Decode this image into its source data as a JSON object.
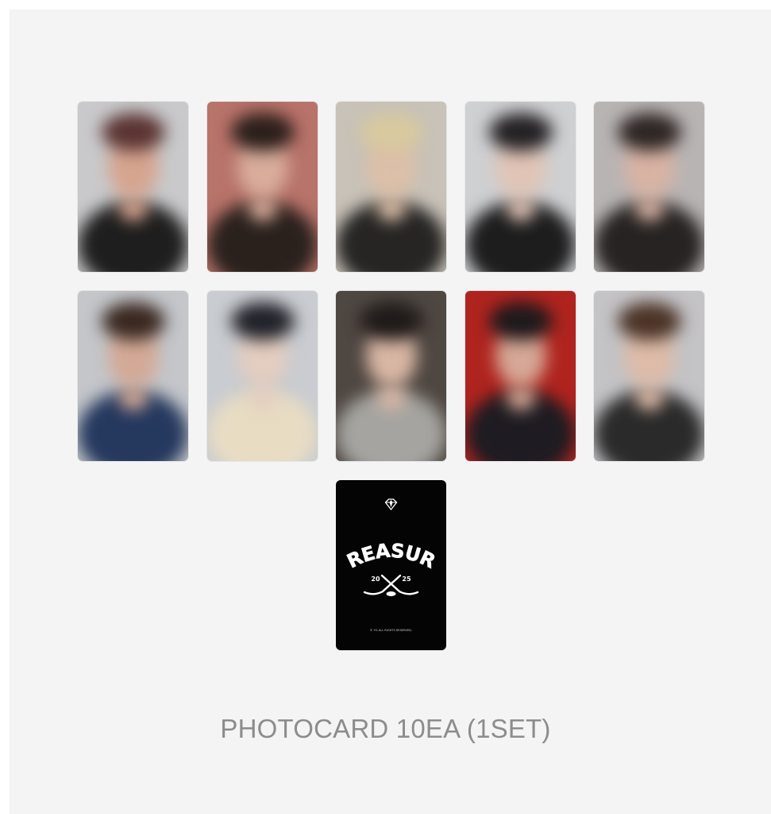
{
  "caption": "PHOTOCARD 10EA (1SET)",
  "back_card": {
    "brand": "TREASURE",
    "year_left": "20",
    "year_right": "25",
    "copyright": "© YG ALL RIGHTS RESERVED."
  },
  "photocards": [
    {
      "bg": "#c9c9cb",
      "hair": "#5a3432",
      "skin": "#d6a48f",
      "cloth": "#1e1e1e"
    },
    {
      "bg": "#b8736a",
      "hair": "#2b1f1b",
      "skin": "#d9ad9c",
      "cloth": "#2a211d"
    },
    {
      "bg": "#c8c2b8",
      "hair": "#d8c99e",
      "skin": "#dcbfa8",
      "cloth": "#262524"
    },
    {
      "bg": "#cfd0d2",
      "hair": "#242124",
      "skin": "#e0c4b6",
      "cloth": "#1d1d1e"
    },
    {
      "bg": "#b9b4b4",
      "hair": "#2e2624",
      "skin": "#d8b3a4",
      "cloth": "#262322"
    },
    {
      "bg": "#c4c6ca",
      "hair": "#3a2820",
      "skin": "#d3a996",
      "cloth": "#25385e"
    },
    {
      "bg": "#c9ccd1",
      "hair": "#22222a",
      "skin": "#e3cdc0",
      "cloth": "#e8dcc3"
    },
    {
      "bg": "#4f4742",
      "hair": "#1f1a19",
      "skin": "#d9b7a5",
      "cloth": "#a5a4a0"
    },
    {
      "bg": "#b0241f",
      "hair": "#1d1a1c",
      "skin": "#d6a896",
      "cloth": "#1e1c22"
    },
    {
      "bg": "#c4c3c6",
      "hair": "#4b3326",
      "skin": "#ddbba8",
      "cloth": "#2a2a2a"
    }
  ]
}
